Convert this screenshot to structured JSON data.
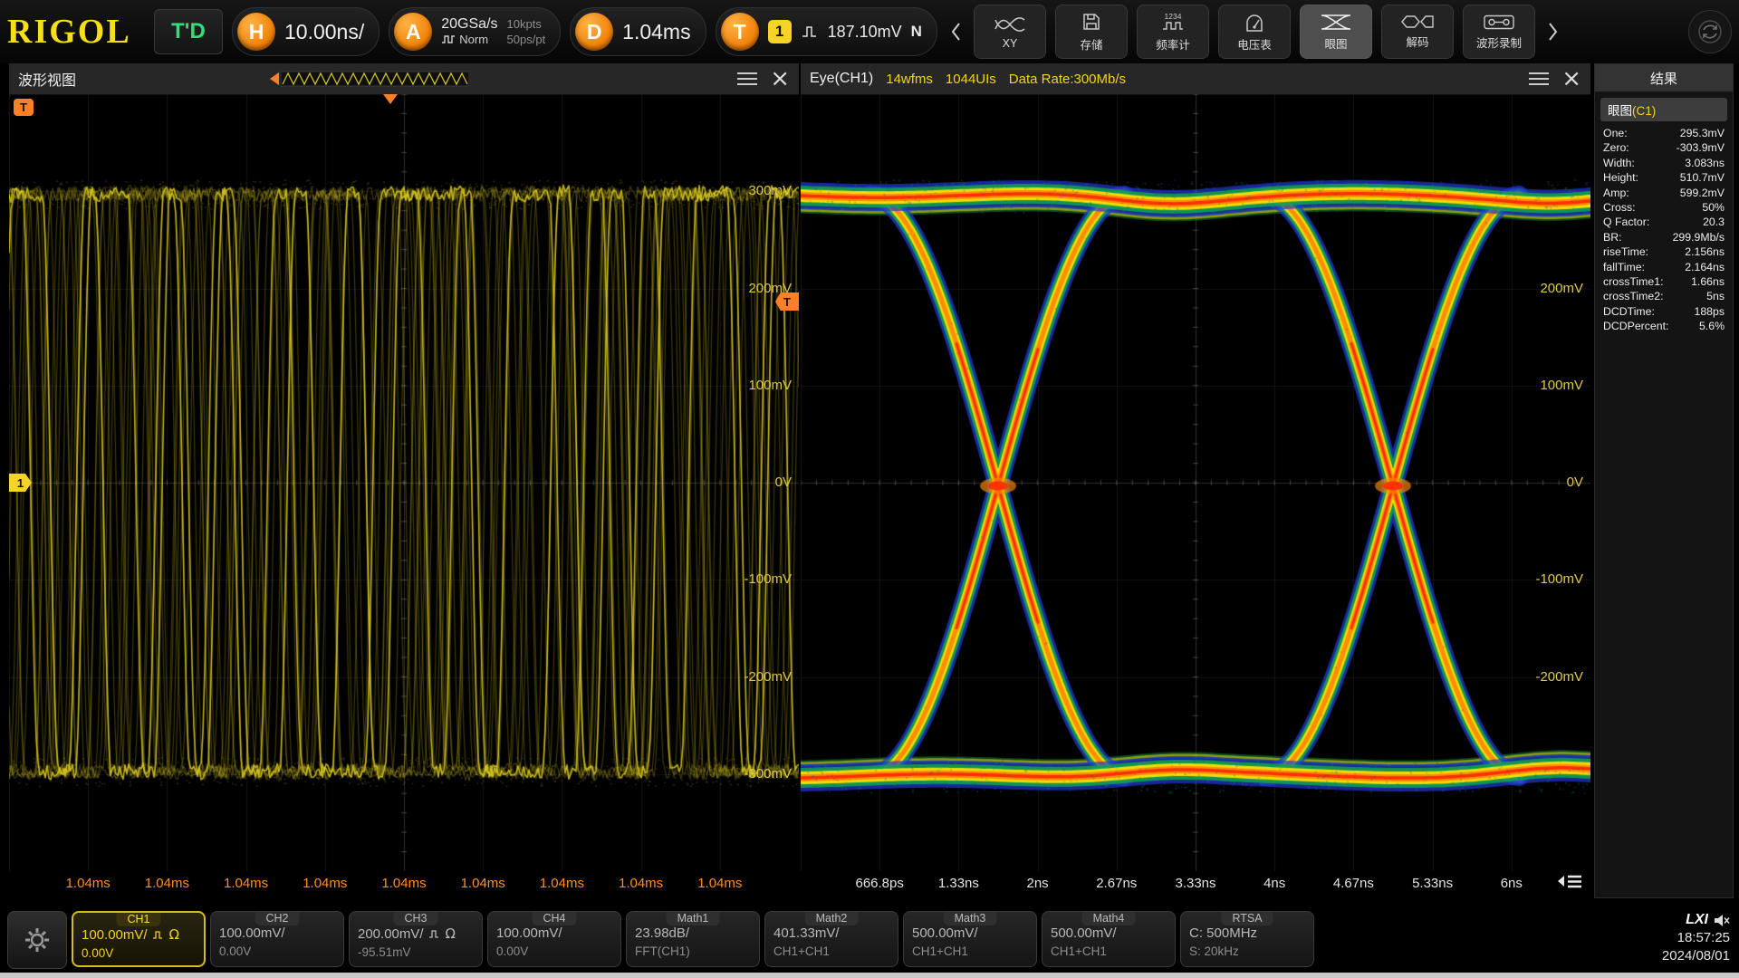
{
  "header": {
    "logo": "RIGOL",
    "trigger_status": "T'D",
    "timebase": {
      "label": "H",
      "value": "10.00ns/"
    },
    "acquisition": {
      "label": "A",
      "rate": "20GSa/s",
      "mode": "Norm",
      "points": "10kpts",
      "resolution": "50ps/pt"
    },
    "delay": {
      "label": "D",
      "value": "1.04ms"
    },
    "trigger": {
      "label": "T",
      "source": "1",
      "level": "187.10mV",
      "slope": "N"
    },
    "toolbar": [
      {
        "id": "xy",
        "label": "XY"
      },
      {
        "id": "storage",
        "label": "存储"
      },
      {
        "id": "counter",
        "label": "频率计",
        "icon_text": "1234"
      },
      {
        "id": "dvm",
        "label": "电压表"
      },
      {
        "id": "eye",
        "label": "眼图",
        "active": true
      },
      {
        "id": "decode",
        "label": "解码"
      },
      {
        "id": "record",
        "label": "波形录制"
      }
    ]
  },
  "waveform_panel": {
    "title": "波形视图",
    "trigger_badge": "T",
    "channel_badge": "1",
    "y_labels": [
      "300mV",
      "200mV",
      "100mV",
      "0V",
      "-100mV",
      "-200mV",
      "-300mV"
    ],
    "x_labels": [
      "1.04ms",
      "1.04ms",
      "1.04ms",
      "1.04ms",
      "1.04ms",
      "1.04ms",
      "1.04ms",
      "1.04ms",
      "1.04ms"
    ]
  },
  "eye_panel": {
    "title": "Eye(CH1)",
    "wfms": "14wfms",
    "uis": "1044UIs",
    "data_rate": "Data Rate:300Mb/s",
    "y_labels": [
      "200mV",
      "100mV",
      "0V",
      "-100mV",
      "-200mV"
    ],
    "x_labels": [
      "666.8ps",
      "1.33ns",
      "2ns",
      "2.67ns",
      "3.33ns",
      "4ns",
      "4.67ns",
      "5.33ns",
      "6ns"
    ]
  },
  "results_panel": {
    "title": "结果",
    "subtitle": "眼图",
    "subtitle_channel": "(C1)",
    "measurements": [
      {
        "label": "One:",
        "value": "295.3mV"
      },
      {
        "label": "Zero:",
        "value": "-303.9mV"
      },
      {
        "label": "Width:",
        "value": "3.083ns"
      },
      {
        "label": "Height:",
        "value": "510.7mV"
      },
      {
        "label": "Amp:",
        "value": "599.2mV"
      },
      {
        "label": "Cross:",
        "value": "50%"
      },
      {
        "label": "Q Factor:",
        "value": "20.3"
      },
      {
        "label": "BR:",
        "value": "299.9Mb/s"
      },
      {
        "label": "riseTime:",
        "value": "2.156ns"
      },
      {
        "label": "fallTime:",
        "value": "2.164ns"
      },
      {
        "label": "crossTime1:",
        "value": "1.66ns"
      },
      {
        "label": "crossTime2:",
        "value": "5ns"
      },
      {
        "label": "DCDTime:",
        "value": "188ps"
      },
      {
        "label": "DCDPercent:",
        "value": "5.6%"
      }
    ]
  },
  "bottom_bar": {
    "channels": [
      {
        "name": "CH1",
        "scale": "100.00mV/",
        "offset": "0.00V",
        "impedance": true,
        "active": true
      },
      {
        "name": "CH2",
        "scale": "100.00mV/",
        "offset": "0.00V",
        "impedance": false,
        "active": false
      },
      {
        "name": "CH3",
        "scale": "200.00mV/",
        "offset": "-95.51mV",
        "impedance": true,
        "active": false
      },
      {
        "name": "CH4",
        "scale": "100.00mV/",
        "offset": "0.00V",
        "impedance": false,
        "active": false
      },
      {
        "name": "Math1",
        "scale": "23.98dB/",
        "offset": "FFT(CH1)",
        "impedance": false,
        "active": false
      },
      {
        "name": "Math2",
        "scale": "401.33mV/",
        "offset": "CH1+CH1",
        "impedance": false,
        "active": false
      },
      {
        "name": "Math3",
        "scale": "500.00mV/",
        "offset": "CH1+CH1",
        "impedance": false,
        "active": false
      },
      {
        "name": "Math4",
        "scale": "500.00mV/",
        "offset": "CH1+CH1",
        "impedance": false,
        "active": false
      },
      {
        "name": "RTSA",
        "scale": "C: 500MHz",
        "offset": "S: 20kHz",
        "impedance": false,
        "active": false
      }
    ],
    "lxi_label": "LXI",
    "time": "18:57:25",
    "date": "2024/08/01"
  },
  "colors": {
    "ch1_yellow": "#f2d21f",
    "accent_orange": "#ff7f27",
    "trig_green": "#2fe07a"
  }
}
